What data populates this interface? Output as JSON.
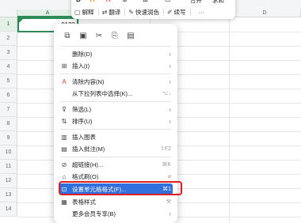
{
  "columns": [
    "A",
    "B",
    "C",
    "D"
  ],
  "rows": [
    "1",
    "2",
    "3",
    "4",
    "5",
    "6",
    "7",
    "8",
    "9",
    "10",
    "11",
    "12",
    "13",
    "14"
  ],
  "cell_a1": "0123",
  "toolbar": {
    "row1": [
      "B",
      "A",
      "A",
      "⊕",
      "⊞",
      "▭",
      "合并",
      "求和"
    ],
    "row2": [
      {
        "icon": "translate-icon",
        "glyph": "▢",
        "label": "解释"
      },
      {
        "icon": "translate-icon",
        "glyph": "🔤",
        "label": "翻译"
      },
      {
        "icon": "paint-icon",
        "glyph": "✎",
        "label": "快速润色"
      },
      {
        "icon": "write-icon",
        "glyph": "✐",
        "label": "续写"
      }
    ],
    "more": "···"
  },
  "menu": {
    "quick_icons": [
      "copy-icon",
      "paste-icon",
      "cut-icon",
      "paste-special-icon",
      "clipboard-icon"
    ],
    "items": [
      {
        "id": "delete",
        "icon": "",
        "label": "删除(D)",
        "shortcut": "",
        "arrow": true
      },
      {
        "id": "insert",
        "icon": "⊞",
        "label": "插入(I)",
        "shortcut": "",
        "arrow": true
      },
      {
        "id": "clear",
        "icon": "A",
        "label": "清除内容(N)",
        "shortcut": "",
        "arrow": true
      },
      {
        "id": "pick",
        "icon": "",
        "label": "从下拉列表中选择(K)...",
        "shortcut": "⌥↓",
        "arrow": false
      },
      {
        "id": "filter",
        "icon": "⊽",
        "label": "筛选(L)",
        "shortcut": "",
        "arrow": true
      },
      {
        "id": "sort",
        "icon": "⇅",
        "label": "排序(U)",
        "shortcut": "",
        "arrow": true
      },
      {
        "id": "chart",
        "icon": "▥",
        "label": "插入图表",
        "shortcut": "",
        "arrow": false
      },
      {
        "id": "comment",
        "icon": "▤",
        "label": "插入批注(M)",
        "shortcut": "⇧F2",
        "arrow": false
      },
      {
        "id": "link",
        "icon": "⊘",
        "label": "超链接(H)...",
        "shortcut": "⌘K",
        "arrow": false
      },
      {
        "id": "format-painter",
        "icon": "⌂",
        "label": "格式刷(O)",
        "shortcut": "",
        "arrow": false
      },
      {
        "id": "format-cells",
        "icon": "⊡",
        "label": "设置单元格格式(F)...",
        "shortcut": "⌘1",
        "arrow": false
      },
      {
        "id": "table-style",
        "icon": "▦",
        "label": "表格样式",
        "shortcut": "",
        "arrow": false
      },
      {
        "id": "member",
        "icon": "",
        "label": "更多会员专享(B)",
        "shortcut": "",
        "arrow": true
      }
    ]
  }
}
